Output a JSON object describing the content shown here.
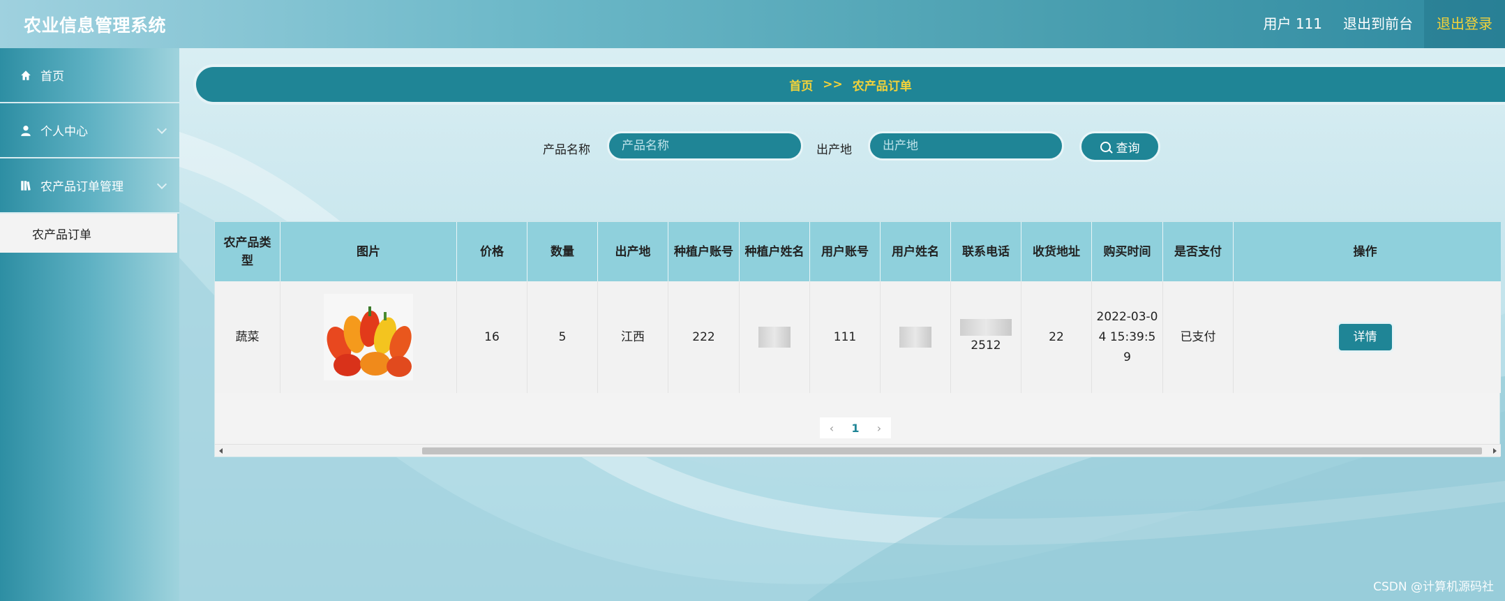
{
  "header": {
    "title": "农业信息管理系统",
    "user_label": "用户 111",
    "front_link": "退出到前台",
    "logout_link": "退出登录"
  },
  "sidebar": {
    "items": [
      {
        "label": "首页",
        "icon": "home-icon"
      },
      {
        "label": "个人中心",
        "icon": "user-icon"
      },
      {
        "label": "农产品订单管理",
        "icon": "book-icon"
      }
    ],
    "sub_item": "农产品订单"
  },
  "breadcrumb": {
    "home": "首页",
    "sep": ">>",
    "current": "农产品订单"
  },
  "search": {
    "name_label": "产品名称",
    "name_placeholder": "产品名称",
    "origin_label": "出产地",
    "origin_placeholder": "出产地",
    "query_button": "查询"
  },
  "table": {
    "headers": [
      "农产品类型",
      "图片",
      "价格",
      "数量",
      "出产地",
      "种植户账号",
      "种植户姓名",
      "用户账号",
      "用户姓名",
      "联系电话",
      "收货地址",
      "购买时间",
      "是否支付",
      "操作"
    ],
    "rows": [
      {
        "type": "蔬菜",
        "price": "16",
        "qty": "5",
        "origin": "江西",
        "farmer_account": "222",
        "user_account": "111",
        "phone_tail": "2512",
        "address": "22",
        "time": "2022-03-04 15:39:59",
        "paid": "已支付",
        "action": "详情"
      }
    ]
  },
  "pager": {
    "prev": "‹",
    "page": "1",
    "next": "›"
  },
  "watermark": "CSDN @计算机源码社",
  "colors": {
    "primary": "#1f8596",
    "accent": "#f2d23a",
    "header_row": "#8fd0dc"
  }
}
